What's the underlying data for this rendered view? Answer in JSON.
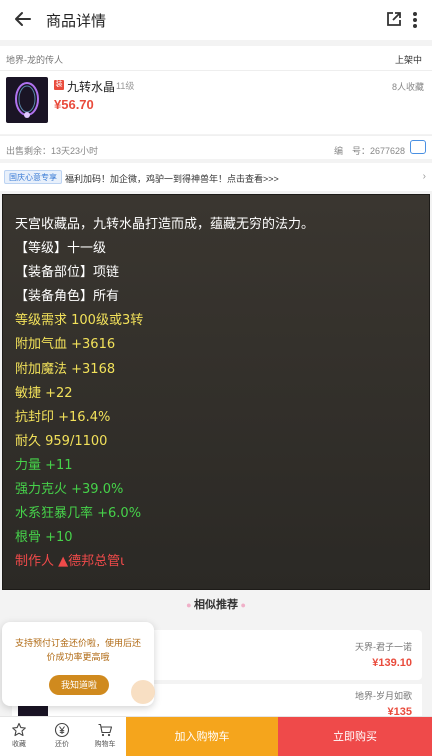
{
  "header": {
    "title": "商品详情"
  },
  "seller": {
    "name": "地界-龙的传人",
    "status": "上架中"
  },
  "item": {
    "badge": "装",
    "name": "九转水晶",
    "level": "11级",
    "price": "¥56.70",
    "favorites": "8人收藏"
  },
  "meta": {
    "time_left": "出售剩余：13天23小时",
    "code": "编　号：2677628"
  },
  "promo": {
    "tag": "国庆心意专享",
    "text": "福利加码！加企微，鸡驴一到得神兽年！点击查看>>>"
  },
  "description": {
    "lines": [
      {
        "text": "天宫收藏品，九转水晶打造而成，蕴藏无穷的法力。",
        "color": "#ffffff"
      },
      {
        "text": "【等级】十一级",
        "color": "#ffffff"
      },
      {
        "text": "【装备部位】项链",
        "color": "#ffffff"
      },
      {
        "text": "【装备角色】所有",
        "color": "#ffffff"
      },
      {
        "text": "等级需求 100级或3转",
        "color": "#f2e15a"
      },
      {
        "text": "附加气血 +3616",
        "color": "#f2e15a"
      },
      {
        "text": "附加魔法 +3168",
        "color": "#f2e15a"
      },
      {
        "text": "敏捷 +22",
        "color": "#f2e15a"
      },
      {
        "text": "抗封印 +16.4%",
        "color": "#f2e15a"
      },
      {
        "text": "耐久 959/1100",
        "color": "#f2e15a"
      },
      {
        "text": "力量 +11",
        "color": "#46d24a"
      },
      {
        "text": "强力克火 +39.0%",
        "color": "#46d24a"
      },
      {
        "text": "水系狂暴几率 +6.0%",
        "color": "#46d24a"
      },
      {
        "text": "根骨 +10",
        "color": "#46d24a"
      },
      {
        "text": "制作人 ▲德邦总管ι",
        "color": "#ef4a4a"
      }
    ]
  },
  "recommend": {
    "title": "相似推荐",
    "items": [
      {
        "seller": "天界-君子一诺",
        "price": "¥139.10"
      },
      {
        "seller": "地界-岁月如歌",
        "price": "¥135"
      }
    ]
  },
  "tip": {
    "text": "支持预付订金还价啦，使用后还价成功率更高哦",
    "button": "我知道啦"
  },
  "bottom": {
    "fav": "收藏",
    "bargain": "还价",
    "cart": "购物车",
    "add_cart": "加入购物车",
    "buy_now": "立即购买"
  },
  "colors": {
    "accent_red": "#ef4a4a",
    "accent_orange": "#f5a51c",
    "promo_blue": "#3a7bd5"
  },
  "icons": [
    "back-arrow-icon",
    "share-icon",
    "more-icon",
    "code-icon",
    "star-icon",
    "yen-icon",
    "cart-icon"
  ]
}
